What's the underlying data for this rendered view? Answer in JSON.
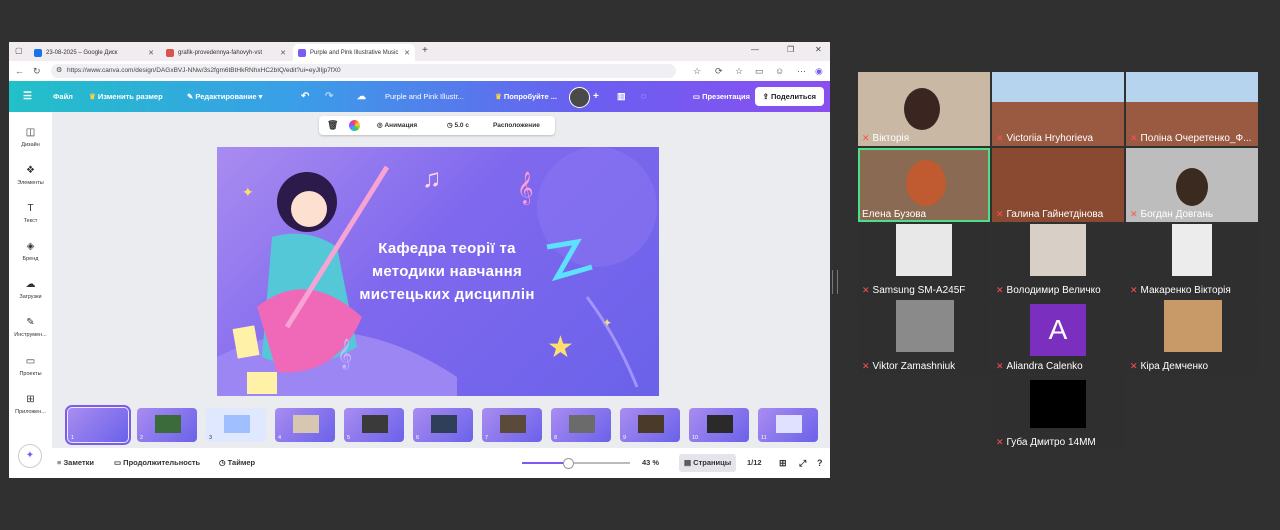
{
  "browser": {
    "tabs": [
      {
        "label": "23-08-2025 – Google Диск",
        "color": "#1a73e8"
      },
      {
        "label": "grafik-provedennya-fahovyh-vst",
        "color": "#d9534f"
      },
      {
        "label": "Purple and Pink Illustrative Music",
        "color": "#7d5af2"
      }
    ],
    "new_tab": "+",
    "url": "https://www.canva.com/design/DAGxBVJ-NNw/3s2fgm6tBtHkRNhxHC2bIQ/edit?ui=eyJlIjp7fX0"
  },
  "canva": {
    "menu": {
      "file": "Файл",
      "resize": "Изменить размер",
      "editing": "Редактирование",
      "doc_title": "Purple and Pink Illustr...",
      "try_pro": "Попробуйте ...",
      "present": "Презентация",
      "share": "Поделиться"
    },
    "leftnav": [
      "Дизайн",
      "Элементы",
      "Текст",
      "Бренд",
      "Загрузки",
      "Инструмен...",
      "Проекты",
      "Приложен..."
    ],
    "element_toolbar": {
      "animation": "Анимация",
      "duration": "5.0 с",
      "position": "Расположение"
    },
    "slide_title": "Кафедра теорії та методики навчання мистецьких дисциплін",
    "thumbnails": [
      "1",
      "2",
      "3",
      "4",
      "5",
      "6",
      "7",
      "8",
      "9",
      "10",
      "11"
    ],
    "bottom": {
      "notes": "Заметки",
      "duration": "Продолжительность",
      "timer": "Таймер",
      "zoom": "43 %",
      "zoom_level": 0.43,
      "pages": "Страницы",
      "page_count": "1/12"
    }
  },
  "participants": [
    "Вікторія",
    "Victoriia Hryhorieva",
    "Поліна Очеретенко_Ф...",
    "Елена Бузова",
    "Галина Гайнетдінова",
    "Богдан Довгань",
    "Samsung SM-A245F",
    "Володимир Величко",
    "Макаренко Вікторія",
    "Viktor Zamashniuk",
    "Aliandra Calenko",
    "Кіра Демченко",
    "Губа Дмитро 14ММ"
  ],
  "avatar_letter": "A",
  "colors": {
    "accent": "#7d5af2",
    "active_speaker": "#4ce088",
    "muted": "#ff5050"
  }
}
